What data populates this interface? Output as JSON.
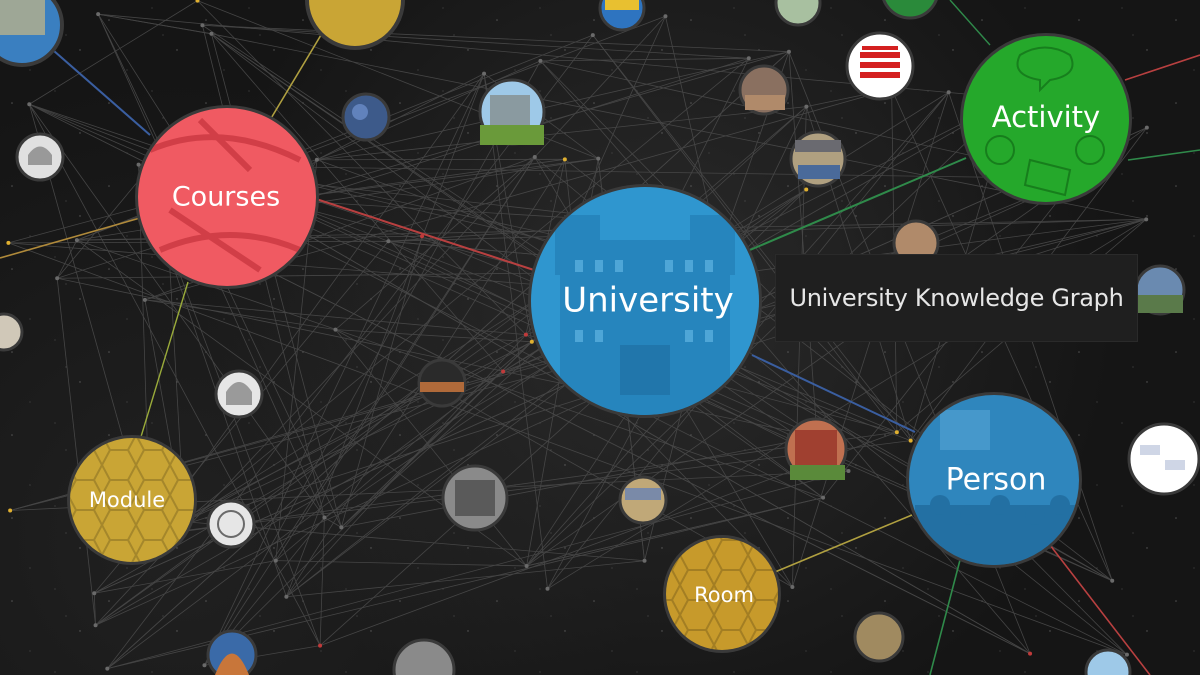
{
  "title": "University Knowledge Graph",
  "nodes": [
    {
      "label": "University",
      "color": "#2f96cf",
      "kind": "building"
    },
    {
      "label": "Courses",
      "color": "#f05a62",
      "kind": "book"
    },
    {
      "label": "Activity",
      "color": "#25a82b",
      "kind": "sketch"
    },
    {
      "label": "Person",
      "color": "#2f86bd",
      "kind": "people"
    },
    {
      "label": "Module",
      "color": "#c9a535",
      "kind": "hex"
    },
    {
      "label": "Room",
      "color": "#c79a2b",
      "kind": "hex"
    }
  ],
  "colors": {
    "background": "#151515",
    "link_red": "#b84040",
    "link_blue": "#3a5ea0",
    "link_green": "#2f8a4a",
    "link_yellow": "#b0a040"
  }
}
